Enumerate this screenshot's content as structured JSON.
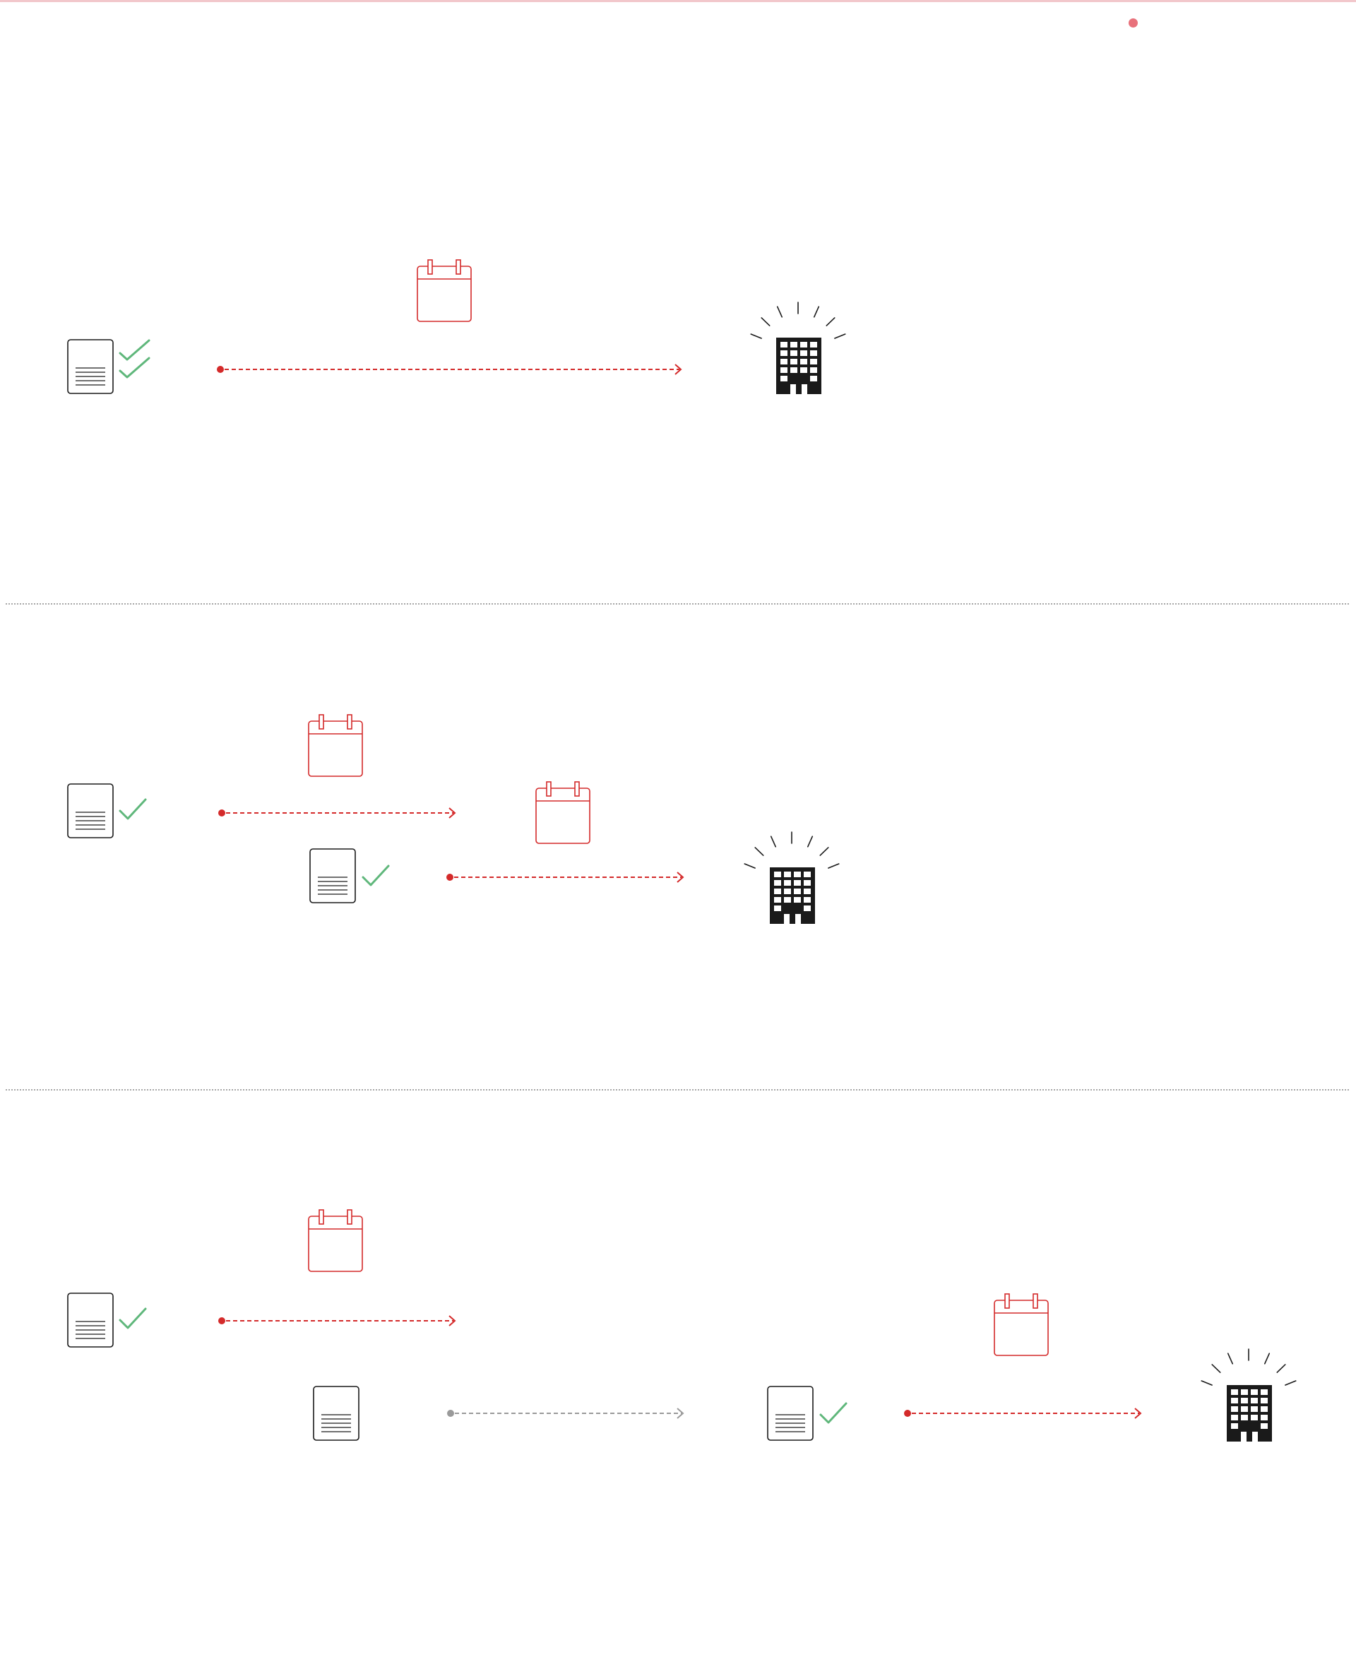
{
  "colors": {
    "accent": "#d42a2a",
    "accent_light": "#f2c7cb",
    "status_dot": "#e8717b",
    "check": "#5fb77b",
    "ink": "#1a1a1a",
    "muted": "#9a9a9a",
    "divider": "#8a8a8a"
  },
  "icons": {
    "document": "document-icon",
    "check": "checkmark-icon",
    "double_check": "double-checkmark-icon",
    "calendar": "calendar-icon",
    "building": "building-icon",
    "arrow": "dashed-arrow"
  },
  "panels": [
    {
      "name": "panel-direct-submission",
      "nodes": [
        {
          "type": "document",
          "check": "double",
          "name": "approved-document"
        },
        {
          "type": "arrow",
          "status": "active",
          "name": "submission-arrow"
        },
        {
          "type": "calendar",
          "name": "deadline-calendar"
        },
        {
          "type": "building",
          "name": "authority-building"
        }
      ]
    },
    {
      "name": "panel-two-step-submission",
      "nodes": [
        {
          "type": "document",
          "check": "single",
          "name": "first-document"
        },
        {
          "type": "arrow",
          "status": "active",
          "name": "first-step-arrow"
        },
        {
          "type": "calendar",
          "name": "first-deadline-calendar"
        },
        {
          "type": "document",
          "check": "single",
          "name": "second-document"
        },
        {
          "type": "arrow",
          "status": "active",
          "name": "second-step-arrow"
        },
        {
          "type": "calendar",
          "name": "second-deadline-calendar"
        },
        {
          "type": "building",
          "name": "authority-building"
        }
      ]
    },
    {
      "name": "panel-pending-review-submission",
      "nodes": [
        {
          "type": "document",
          "check": "single",
          "name": "first-document"
        },
        {
          "type": "arrow",
          "status": "active",
          "name": "first-step-arrow"
        },
        {
          "type": "calendar",
          "name": "first-deadline-calendar"
        },
        {
          "type": "document",
          "check": "none",
          "name": "pending-document"
        },
        {
          "type": "arrow",
          "status": "inactive",
          "name": "pending-arrow"
        },
        {
          "type": "document",
          "check": "single",
          "name": "reviewed-document"
        },
        {
          "type": "arrow",
          "status": "active",
          "name": "final-step-arrow"
        },
        {
          "type": "calendar",
          "name": "final-deadline-calendar"
        },
        {
          "type": "building",
          "name": "authority-building"
        }
      ]
    }
  ]
}
